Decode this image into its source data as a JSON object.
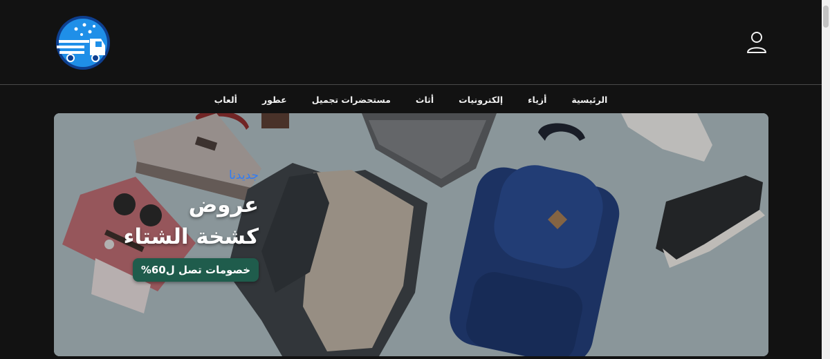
{
  "header": {
    "logo_icon": "delivery-truck-logo",
    "account_icon": "user-icon"
  },
  "nav": {
    "items": [
      {
        "label": "الرئيسية"
      },
      {
        "label": "أزياء"
      },
      {
        "label": "إلكترونيات"
      },
      {
        "label": "أثاث"
      },
      {
        "label": "مستحضرات تجميل"
      },
      {
        "label": "عطور"
      },
      {
        "label": "ألعاب"
      }
    ]
  },
  "hero": {
    "tagline": "جديدنا",
    "title_line1": "عروض",
    "title_line2": "كشخة الشتاء",
    "cta_label": "خصومات تصل ل60%",
    "colors": {
      "tagline": "#2f7cf6",
      "cta": "#1f5c4c",
      "background": "#a8b6bb"
    }
  }
}
